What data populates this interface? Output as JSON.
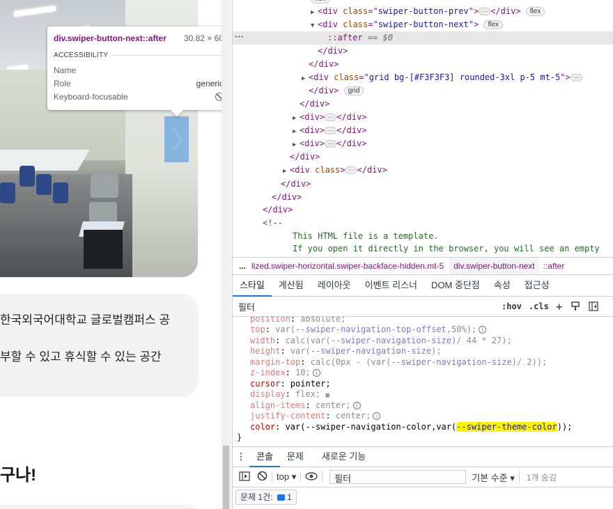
{
  "page": {
    "line1": "한국외국어대학교 글로벌캠퍼스 공",
    "line2": "부할 수 있고 휴식할 수 있는 공간",
    "heading": "구나!"
  },
  "tooltip": {
    "selector": "div.swiper-button-next::after",
    "dimensions": "30.82 × 60",
    "section": "ACCESSIBILITY",
    "rows": [
      {
        "label": "Name",
        "value": ""
      },
      {
        "label": "Role",
        "value": "generic"
      },
      {
        "label": "Keyboard-focusable",
        "value": ""
      }
    ]
  },
  "elements": {
    "lines": [
      {
        "html_prev": "swiper-button-prev",
        "badge": "flex"
      },
      {
        "next": "swiper-button-next",
        "badge": "flex"
      },
      {
        "pseudo": "::after",
        "eq": "== $0"
      },
      {
        "grid_class": "grid bg-[#F3F3F3] rounded-3xl    p-5 mt-5",
        "badge": "grid"
      }
    ],
    "comment1": "This HTML file is a template.",
    "comment2": "If you open it directly in the browser, you will see an empty"
  },
  "breadcrumb": {
    "more": "...",
    "c1": "lized.swiper-horizontal.swiper-backface-hidden.mt-5",
    "c2": "div.swiper-button-next",
    "c3": "::after"
  },
  "tabs": [
    "스타일",
    "계산됨",
    "레이아웃",
    "이벤트 리스너",
    "DOM 중단점",
    "속성",
    "접근성"
  ],
  "filter": {
    "placeholder": "필터",
    "hov": ":hov",
    "cls": ".cls",
    "plus": "+"
  },
  "styles": {
    "highlight": "--swiper-theme-color"
  },
  "drawer": {
    "tabs": [
      "콘솔",
      "문제",
      "새로운 기능"
    ],
    "top": "top",
    "filter": "필터",
    "level": "기본 수준",
    "hidden": "1개 숨김",
    "issues": "문제 1건:",
    "issues_count": "1"
  },
  "colors": {
    "accent": "#1a73e8",
    "highlight": "#fff200",
    "swiper_button": "#6fa8dc"
  }
}
